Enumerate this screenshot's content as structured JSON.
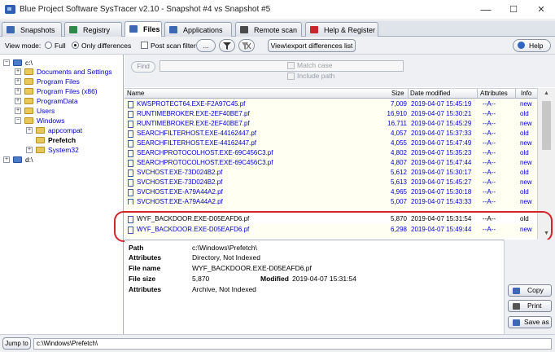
{
  "window": {
    "title": "Blue Project Software SysTracer v2.10 - Snapshot #4 vs Snapshot #5",
    "minimize_glyph": "—",
    "maximize_glyph": "☐",
    "close_glyph": "✕"
  },
  "tabs": [
    {
      "label": "Snapshots",
      "icon": "camera-icon",
      "color": "#3e67b4"
    },
    {
      "label": "Registry",
      "icon": "registry-icon",
      "color": "#2d8a4b"
    },
    {
      "label": "Files",
      "icon": "files-icon",
      "color": "#3e67b4",
      "active": true
    },
    {
      "label": "Applications",
      "icon": "applications-icon",
      "color": "#3e67b4"
    },
    {
      "label": "Remote scan",
      "icon": "network-icon",
      "color": "#4b4b4b"
    },
    {
      "label": "Help & Register",
      "icon": "help-book-icon",
      "color": "#c6282d"
    }
  ],
  "toolbar": {
    "view_mode_label": "View mode:",
    "full_label": "Full",
    "only_differences_label": "Only differences",
    "post_scan_filter_label": "Post scan filter",
    "ellipsis_label": "...",
    "export_label": "View\\export differences list",
    "help_label": "Help"
  },
  "find": {
    "find_label": "Find",
    "match_case_label": "Match case",
    "include_path_label": "Include path"
  },
  "tree": [
    {
      "label": "c:\\",
      "level": 0,
      "expander": "−",
      "kind": "drive"
    },
    {
      "label": "Documents and Settings",
      "level": 1,
      "expander": "+",
      "kind": "folder"
    },
    {
      "label": "Program Files",
      "level": 1,
      "expander": "+",
      "kind": "folder"
    },
    {
      "label": "Program Files (x86)",
      "level": 1,
      "expander": "+",
      "kind": "folder"
    },
    {
      "label": "ProgramData",
      "level": 1,
      "expander": "+",
      "kind": "folder"
    },
    {
      "label": "Users",
      "level": 1,
      "expander": "+",
      "kind": "folder"
    },
    {
      "label": "Windows",
      "level": 1,
      "expander": "−",
      "kind": "folder"
    },
    {
      "label": "appcompat",
      "level": 2,
      "expander": "+",
      "kind": "folder"
    },
    {
      "label": "Prefetch",
      "level": 2,
      "expander": "",
      "kind": "folder",
      "selected": true
    },
    {
      "label": "System32",
      "level": 2,
      "expander": "+",
      "kind": "folder"
    },
    {
      "label": "d:\\",
      "level": 0,
      "expander": "+",
      "kind": "drive"
    }
  ],
  "columns": {
    "name": "Name",
    "size": "Size",
    "date": "Date modified",
    "attributes": "Attributes",
    "info": "Info"
  },
  "rows": [
    {
      "name": "KWSPROTECT64.EXE-F2A97C45.pf",
      "size": "7,009",
      "date": "2019-04-07 15:45:19",
      "attr": "--A--",
      "info": "new"
    },
    {
      "name": "RUNTIMEBROKER.EXE-2EF40BE7.pf",
      "size": "16,910",
      "date": "2019-04-07 15:30:21",
      "attr": "--A--",
      "info": "old"
    },
    {
      "name": "RUNTIMEBROKER.EXE-2EF40BE7.pf",
      "size": "16,711",
      "date": "2019-04-07 15:45:29",
      "attr": "--A--",
      "info": "new"
    },
    {
      "name": "SEARCHFILTERHOST.EXE-44162447.pf",
      "size": "4,057",
      "date": "2019-04-07 15:37:33",
      "attr": "--A--",
      "info": "old"
    },
    {
      "name": "SEARCHFILTERHOST.EXE-44162447.pf",
      "size": "4,055",
      "date": "2019-04-07 15:47:49",
      "attr": "--A--",
      "info": "new"
    },
    {
      "name": "SEARCHPROTOCOLHOST.EXE-69C456C3.pf",
      "size": "4,802",
      "date": "2019-04-07 15:35:23",
      "attr": "--A--",
      "info": "old"
    },
    {
      "name": "SEARCHPROTOCOLHOST.EXE-69C456C3.pf",
      "size": "4,807",
      "date": "2019-04-07 15:47:44",
      "attr": "--A--",
      "info": "new"
    },
    {
      "name": "SVCHOST.EXE-73D024B2.pf",
      "size": "5,612",
      "date": "2019-04-07 15:30:17",
      "attr": "--A--",
      "info": "old"
    },
    {
      "name": "SVCHOST.EXE-73D024B2.pf",
      "size": "5,613",
      "date": "2019-04-07 15:45:27",
      "attr": "--A--",
      "info": "new"
    },
    {
      "name": "SVCHOST.EXE-A79A44A2.pf",
      "size": "4,965",
      "date": "2019-04-07 15:30:18",
      "attr": "--A--",
      "info": "old"
    },
    {
      "name": "SVCHOST.EXE-A79A44A2.pf",
      "size": "5,007",
      "date": "2019-04-07 15:43:33",
      "attr": "--A--",
      "info": "new"
    },
    {
      "name": "WYF_BACKDOOR.EXE-D05EAFD6.pf",
      "size": "5,870",
      "date": "2019-04-07 15:31:54",
      "attr": "--A--",
      "info": "old",
      "selected": true
    },
    {
      "name": "WYF_BACKDOOR.EXE-D05EAFD6.pf",
      "size": "6,298",
      "date": "2019-04-07 15:49:44",
      "attr": "--A--",
      "info": "new"
    }
  ],
  "details": {
    "path_label": "Path",
    "path_value": "c:\\Windows\\Prefetch\\",
    "attributes_label": "Attributes",
    "attributes_value": "Directory, Not Indexed",
    "filename_label": "File name",
    "filename_value": "WYF_BACKDOOR.EXE-D05EAFD6.pf",
    "filesize_label": "File size",
    "filesize_value": "5,870",
    "modified_label": "Modified",
    "modified_value": "2019-04-07 15:31:54",
    "attributes2_label": "Attributes",
    "attributes2_value": "Archive, Not Indexed"
  },
  "side_buttons": {
    "copy_label": "Copy",
    "print_label": "Print",
    "save_label": "Save as"
  },
  "bottom": {
    "jump_label": "Jump to",
    "path_value": "c:\\Windows\\Prefetch\\"
  },
  "colors": {
    "link_blue": "#0000cc",
    "list_background": "#fffff2",
    "highlight_red": "#d3232b"
  }
}
